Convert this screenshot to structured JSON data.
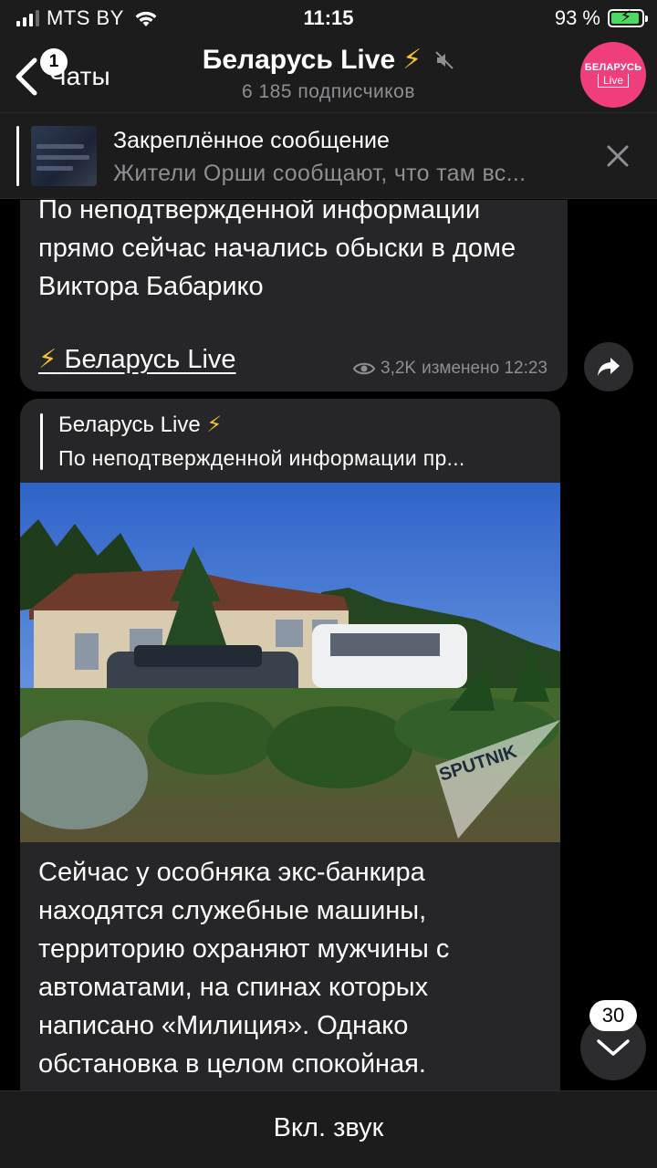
{
  "status_bar": {
    "carrier": "MTS BY",
    "time": "11:15",
    "battery_percent": "93 %",
    "battery_level": 0.93,
    "signal_bars_active": 3,
    "signal_bars_total": 4
  },
  "header": {
    "back_label": "Чаты",
    "back_badge": "1",
    "title": "Беларусь Live",
    "title_bolt": "⚡",
    "subtitle": "6 185 подписчиков",
    "avatar_line1": "БЕЛАРУСЬ",
    "avatar_line2": "Live",
    "avatar_color": "#f03e7c"
  },
  "pinned": {
    "title": "Закреплённое сообщение",
    "text": "Жители Орши сообщают, что там вс..."
  },
  "messages": [
    {
      "text": "По неподтвержденной информации прямо сейчас начались обыски в доме Виктора Бабарико",
      "link_bolt": "⚡",
      "link": "Беларусь Live",
      "views": "3,2K",
      "meta": "изменено 12:23"
    },
    {
      "forward_from": "Беларусь Live",
      "forward_bolt": "⚡",
      "forward_text": "По неподтвержденной информации пр...",
      "photo_watermark": "SPUTNIK",
      "text": "Сейчас у особняка экс-банкира находятся служебные машины, территорию охраняют мужчины с автоматами, на спинах которых написано «Милиция». Однако обстановка в целом спокойная."
    }
  ],
  "scroll_button": {
    "unread_count": "30"
  },
  "bottom": {
    "unmute_label": "Вкл. звук"
  },
  "icons": {
    "back": "chevron-left-icon",
    "mute": "muted-speaker-icon",
    "close": "close-icon",
    "views": "eye-icon",
    "share": "share-arrow-icon",
    "scroll": "chevron-down-icon"
  }
}
